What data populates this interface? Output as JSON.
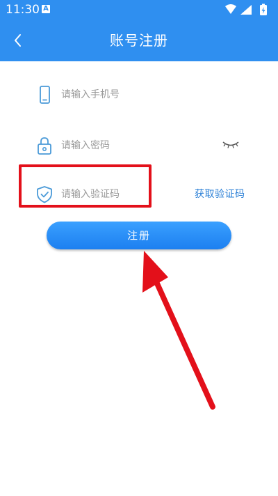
{
  "status_bar": {
    "time": "11:30",
    "notification_icon": "a-badge-icon",
    "icons": [
      "wifi-icon",
      "signal-icon",
      "battery-charging-icon"
    ]
  },
  "nav": {
    "back_icon": "chevron-left-icon",
    "title": "账号注册"
  },
  "form": {
    "phone": {
      "icon": "phone-icon",
      "placeholder": "请输入手机号"
    },
    "password": {
      "icon": "lock-icon",
      "placeholder": "请输入密码",
      "toggle_icon": "eye-closed-icon"
    },
    "code": {
      "icon": "shield-check-icon",
      "placeholder": "请输入验证码",
      "get_code_label": "获取验证码"
    },
    "submit_label": "注册"
  },
  "annotations": {
    "highlight_color": "#e3101a",
    "arrow_color": "#e3101a"
  },
  "colors": {
    "primary": "#2f8ff0",
    "link": "#2a7fd6",
    "placeholder": "#9a9a9a"
  }
}
